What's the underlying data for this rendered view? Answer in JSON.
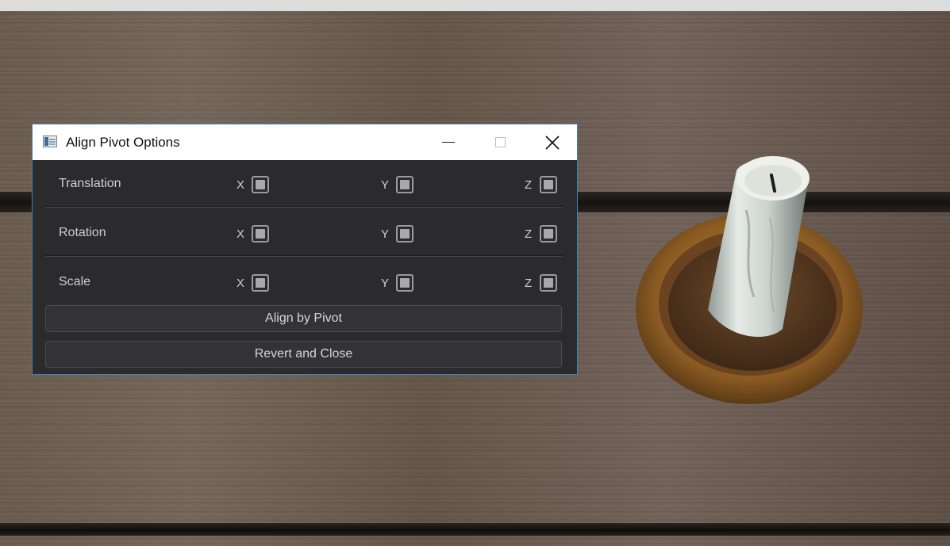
{
  "dialog": {
    "title": "Align Pivot Options",
    "rows": [
      {
        "label": "Translation",
        "x": "X",
        "y": "Y",
        "z": "Z",
        "x_checked": true,
        "y_checked": true,
        "z_checked": true
      },
      {
        "label": "Rotation",
        "x": "X",
        "y": "Y",
        "z": "Z",
        "x_checked": true,
        "y_checked": true,
        "z_checked": true
      },
      {
        "label": "Scale",
        "x": "X",
        "y": "Y",
        "z": "Z",
        "x_checked": true,
        "y_checked": true,
        "z_checked": true
      }
    ],
    "buttons": {
      "align": "Align by Pivot",
      "revert": "Revert and Close"
    },
    "icons": {
      "app": "app-window-icon",
      "minimize": "minimize-icon",
      "maximize": "maximize-icon",
      "close": "close-icon"
    }
  },
  "colors": {
    "dialog_bg": "#2b2b2d",
    "titlebar_bg": "#ffffff",
    "border_accent": "#3e7fc4",
    "text": "#cfcfcf"
  },
  "scene": {
    "description_icon": "candle-on-dish"
  }
}
